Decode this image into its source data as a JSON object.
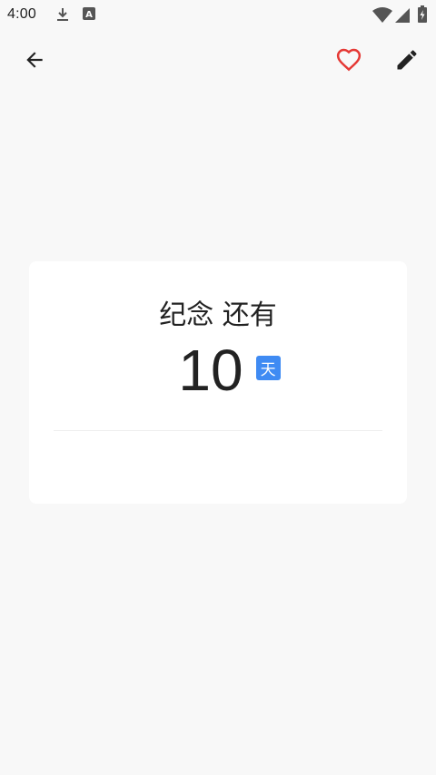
{
  "status_bar": {
    "time": "4:00",
    "icons": [
      "download-icon",
      "a-box-icon",
      "wifi-icon",
      "signal-icon",
      "battery-icon"
    ]
  },
  "toolbar": {
    "back_icon": "back-arrow-icon",
    "favorite_icon": "heart-icon",
    "edit_icon": "pencil-icon",
    "favorite_color": "#e53935"
  },
  "card": {
    "title": "纪念 还有",
    "count": "10",
    "unit": "天",
    "unit_color": "#3f8bf3"
  }
}
